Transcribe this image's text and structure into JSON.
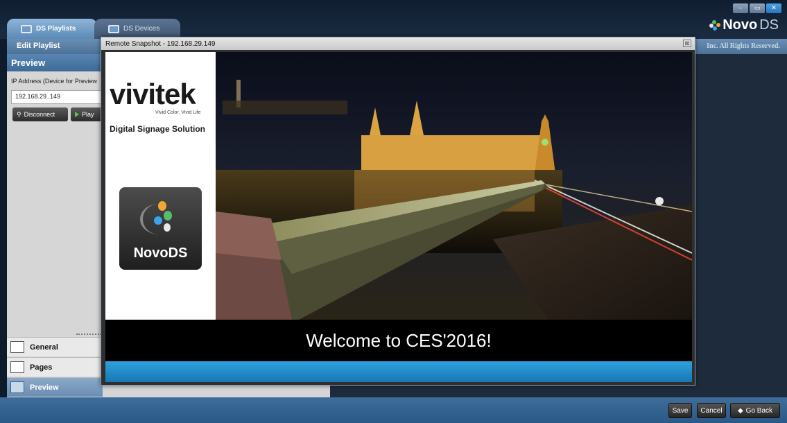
{
  "tabs": [
    {
      "label": "DS Playlists",
      "active": true
    },
    {
      "label": "DS Devices",
      "active": false
    }
  ],
  "window_controls": {
    "minimize": "–",
    "maximize": "▭",
    "close": "✕"
  },
  "brand": {
    "novo": "Novo",
    "ds": "DS"
  },
  "subheader": {
    "title": "Edit Playlist",
    "copyright": "Inc. All Rights Reserved."
  },
  "left_panel": {
    "header": "Preview",
    "ip_label": "IP Address (Device for Preview",
    "ip_value": "192.168.29 .149",
    "disconnect_label": "Disconnect",
    "play_label": "Play"
  },
  "nav": [
    {
      "label": "General",
      "icon": "general-icon"
    },
    {
      "label": "Pages",
      "icon": "pages-icon"
    },
    {
      "label": "Preview",
      "icon": "preview-icon",
      "active": true
    }
  ],
  "dialog": {
    "title": "Remote Snapshot - 192.168.29.149",
    "close": "⊠",
    "brand_name": "vivitek",
    "brand_tagline": "Vivid Color, Vivid Life",
    "brand_subtitle": "Digital Signage Solution",
    "app_tile_label": "NovoDS",
    "welcome_text": "Welcome to CES'2016!"
  },
  "bottom_bar": {
    "save": "Save",
    "cancel": "Cancel",
    "go_back": "Go Back"
  },
  "colors": {
    "accent_blue": "#2fa0e0",
    "header_blue": "#4c7196",
    "dark_bg": "#0d1b2a"
  }
}
